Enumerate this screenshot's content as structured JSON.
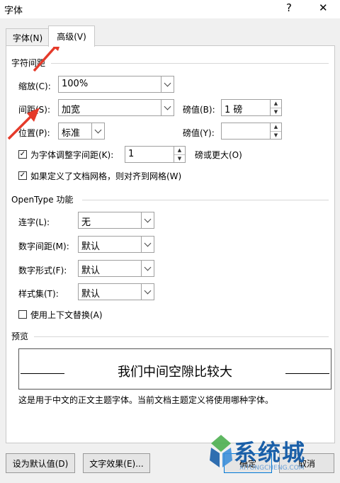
{
  "window": {
    "title": "字体",
    "help_glyph": "?",
    "close_glyph": "✕"
  },
  "tabs": [
    {
      "label": "字体(N)"
    },
    {
      "label": "高级(V)"
    }
  ],
  "spacing": {
    "section_title": "字符间距",
    "scale_label": "缩放(C):",
    "scale_value": "100%",
    "spacing_label": "间距(S):",
    "spacing_value": "加宽",
    "spacing_by_label": "磅值(B):",
    "spacing_by_value": "1 磅",
    "position_label": "位置(P):",
    "position_value": "标准",
    "position_by_label": "磅值(Y):",
    "position_by_value": "",
    "kerning_label": "为字体调整字间距(K):",
    "kerning_checked": true,
    "kerning_value": "1",
    "kerning_suffix": "磅或更大(O)",
    "grid_label": "如果定义了文档网格，则对齐到网格(W)",
    "grid_checked": true
  },
  "opentype": {
    "section_title": "OpenType 功能",
    "ligatures_label": "连字(L):",
    "ligatures_value": "无",
    "num_spacing_label": "数字间距(M):",
    "num_spacing_value": "默认",
    "num_forms_label": "数字形式(F):",
    "num_forms_value": "默认",
    "stylistic_label": "样式集(T):",
    "stylistic_value": "默认",
    "contextual_label": "使用上下文替换(A)",
    "contextual_checked": false
  },
  "preview": {
    "section_title": "预览",
    "sample_text": "我们中间空隙比较大",
    "description": "这是用于中文的正文主题字体。当前文档主题定义将使用哪种字体。"
  },
  "buttons": {
    "set_default": "设为默认值(D)",
    "text_effects": "文字效果(E)...",
    "ok": "确定",
    "cancel": "取消"
  },
  "watermark": {
    "brand": "系统城",
    "domain": "XITONGCHENG.COM"
  },
  "colors": {
    "annotation_arrow": "#e53a2a",
    "watermark_blue": "#1a5fa8"
  }
}
